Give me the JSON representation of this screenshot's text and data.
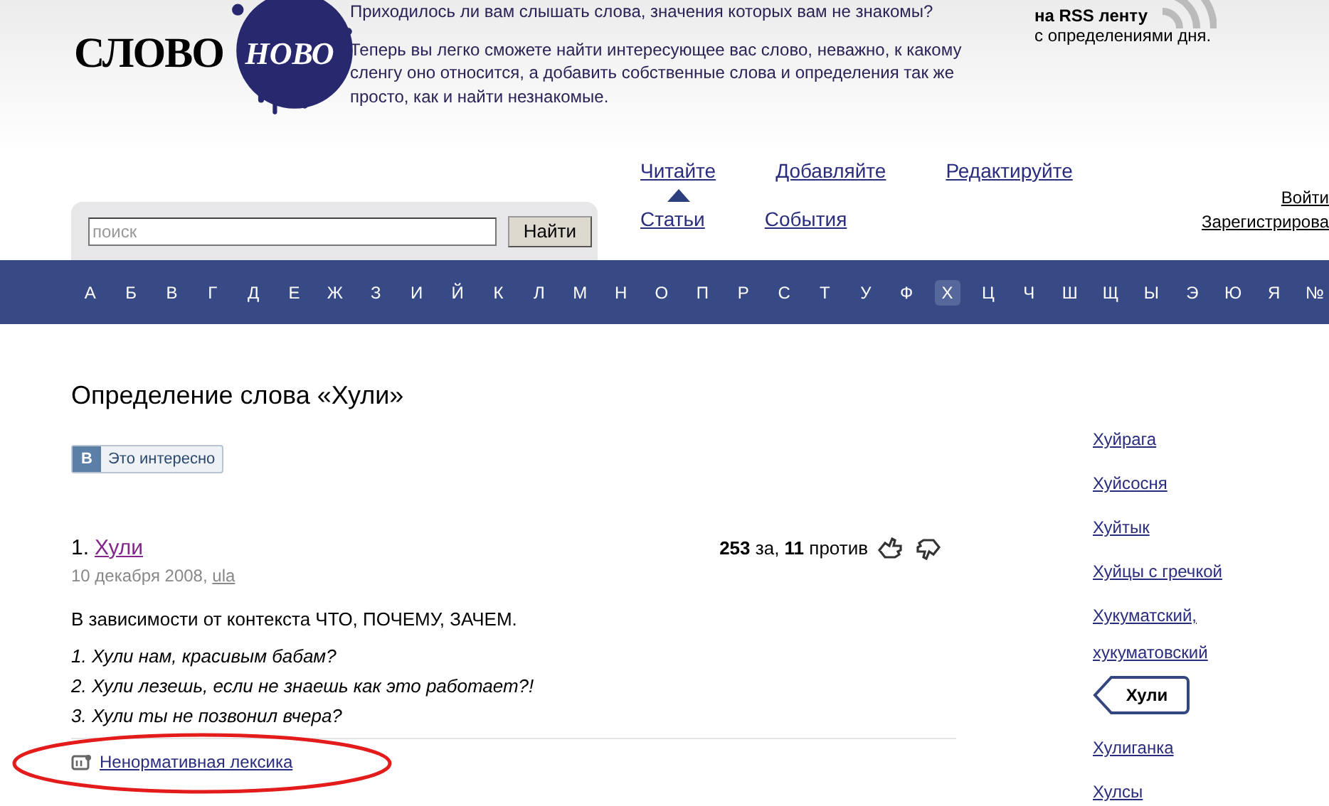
{
  "header": {
    "logo": {
      "word1": "СЛОВО",
      "word2": "НОВО"
    },
    "intro": [
      "Приходилось ли вам слышать слова, значения которых вам не знакомы?",
      "Теперь вы легко сможете найти интересующее вас слово, неважно, к какому сленгу оно относится, а добавить собственные слова и определения так же просто, как и найти незнакомые."
    ],
    "rss": {
      "title": "на RSS ленту",
      "subtitle": "с определениями дня."
    }
  },
  "nav": {
    "primary": [
      {
        "label": "Читайте",
        "selected": true
      },
      {
        "label": "Добавляйте",
        "selected": false
      },
      {
        "label": "Редактируйте",
        "selected": false
      }
    ],
    "secondary": [
      {
        "label": "Статьи"
      },
      {
        "label": "События"
      }
    ]
  },
  "search": {
    "placeholder": "поиск",
    "button": "Найти"
  },
  "auth": [
    "Войти",
    "Зарегистрирова"
  ],
  "alphabet": [
    {
      "letter": "А",
      "selected": false
    },
    {
      "letter": "Б",
      "selected": false
    },
    {
      "letter": "В",
      "selected": false
    },
    {
      "letter": "Г",
      "selected": false
    },
    {
      "letter": "Д",
      "selected": false
    },
    {
      "letter": "Е",
      "selected": false
    },
    {
      "letter": "Ж",
      "selected": false
    },
    {
      "letter": "З",
      "selected": false
    },
    {
      "letter": "И",
      "selected": false
    },
    {
      "letter": "Й",
      "selected": false
    },
    {
      "letter": "К",
      "selected": false
    },
    {
      "letter": "Л",
      "selected": false
    },
    {
      "letter": "М",
      "selected": false
    },
    {
      "letter": "Н",
      "selected": false
    },
    {
      "letter": "О",
      "selected": false
    },
    {
      "letter": "П",
      "selected": false
    },
    {
      "letter": "Р",
      "selected": false
    },
    {
      "letter": "С",
      "selected": false
    },
    {
      "letter": "Т",
      "selected": false
    },
    {
      "letter": "У",
      "selected": false
    },
    {
      "letter": "Ф",
      "selected": false
    },
    {
      "letter": "Х",
      "selected": true
    },
    {
      "letter": "Ц",
      "selected": false
    },
    {
      "letter": "Ч",
      "selected": false
    },
    {
      "letter": "Ш",
      "selected": false
    },
    {
      "letter": "Щ",
      "selected": false
    },
    {
      "letter": "Ы",
      "selected": false
    },
    {
      "letter": "Э",
      "selected": false
    },
    {
      "letter": "Ю",
      "selected": false
    },
    {
      "letter": "Я",
      "selected": false
    },
    {
      "letter": "№",
      "selected": false
    }
  ],
  "page_title": "Определение слова «Хули»",
  "like_button": {
    "badge": "В",
    "label": "Это интересно"
  },
  "entry": {
    "number": "1.",
    "word": "Хули",
    "date": "10 декабря 2008,",
    "author": "ula",
    "votes": "**253** за, **11** против",
    "text": "В зависимости от контекста ЧТО, ПОЧЕМУ, ЗАЧЕМ.",
    "examples": [
      "1. Хули нам, красивым бабам?",
      "2. Хули лезешь, если не знаешь как это работает?!",
      "3. Хули ты не позвонил вчера?"
    ],
    "tag": "Ненормативная лексика"
  },
  "sidebar": {
    "items": [
      {
        "label": "Хуйрага",
        "selected": false
      },
      {
        "label": "Хуйсосня",
        "selected": false
      },
      {
        "label": "Хуйтык",
        "selected": false
      },
      {
        "label": "Хуйцы с гречкой",
        "selected": false
      },
      {
        "label": "Хукуматский, хукуматовский",
        "selected": false
      },
      {
        "label": "Хули",
        "selected": true
      },
      {
        "label": "Хулиганка",
        "selected": false
      },
      {
        "label": "Хулсы",
        "selected": false
      }
    ]
  }
}
